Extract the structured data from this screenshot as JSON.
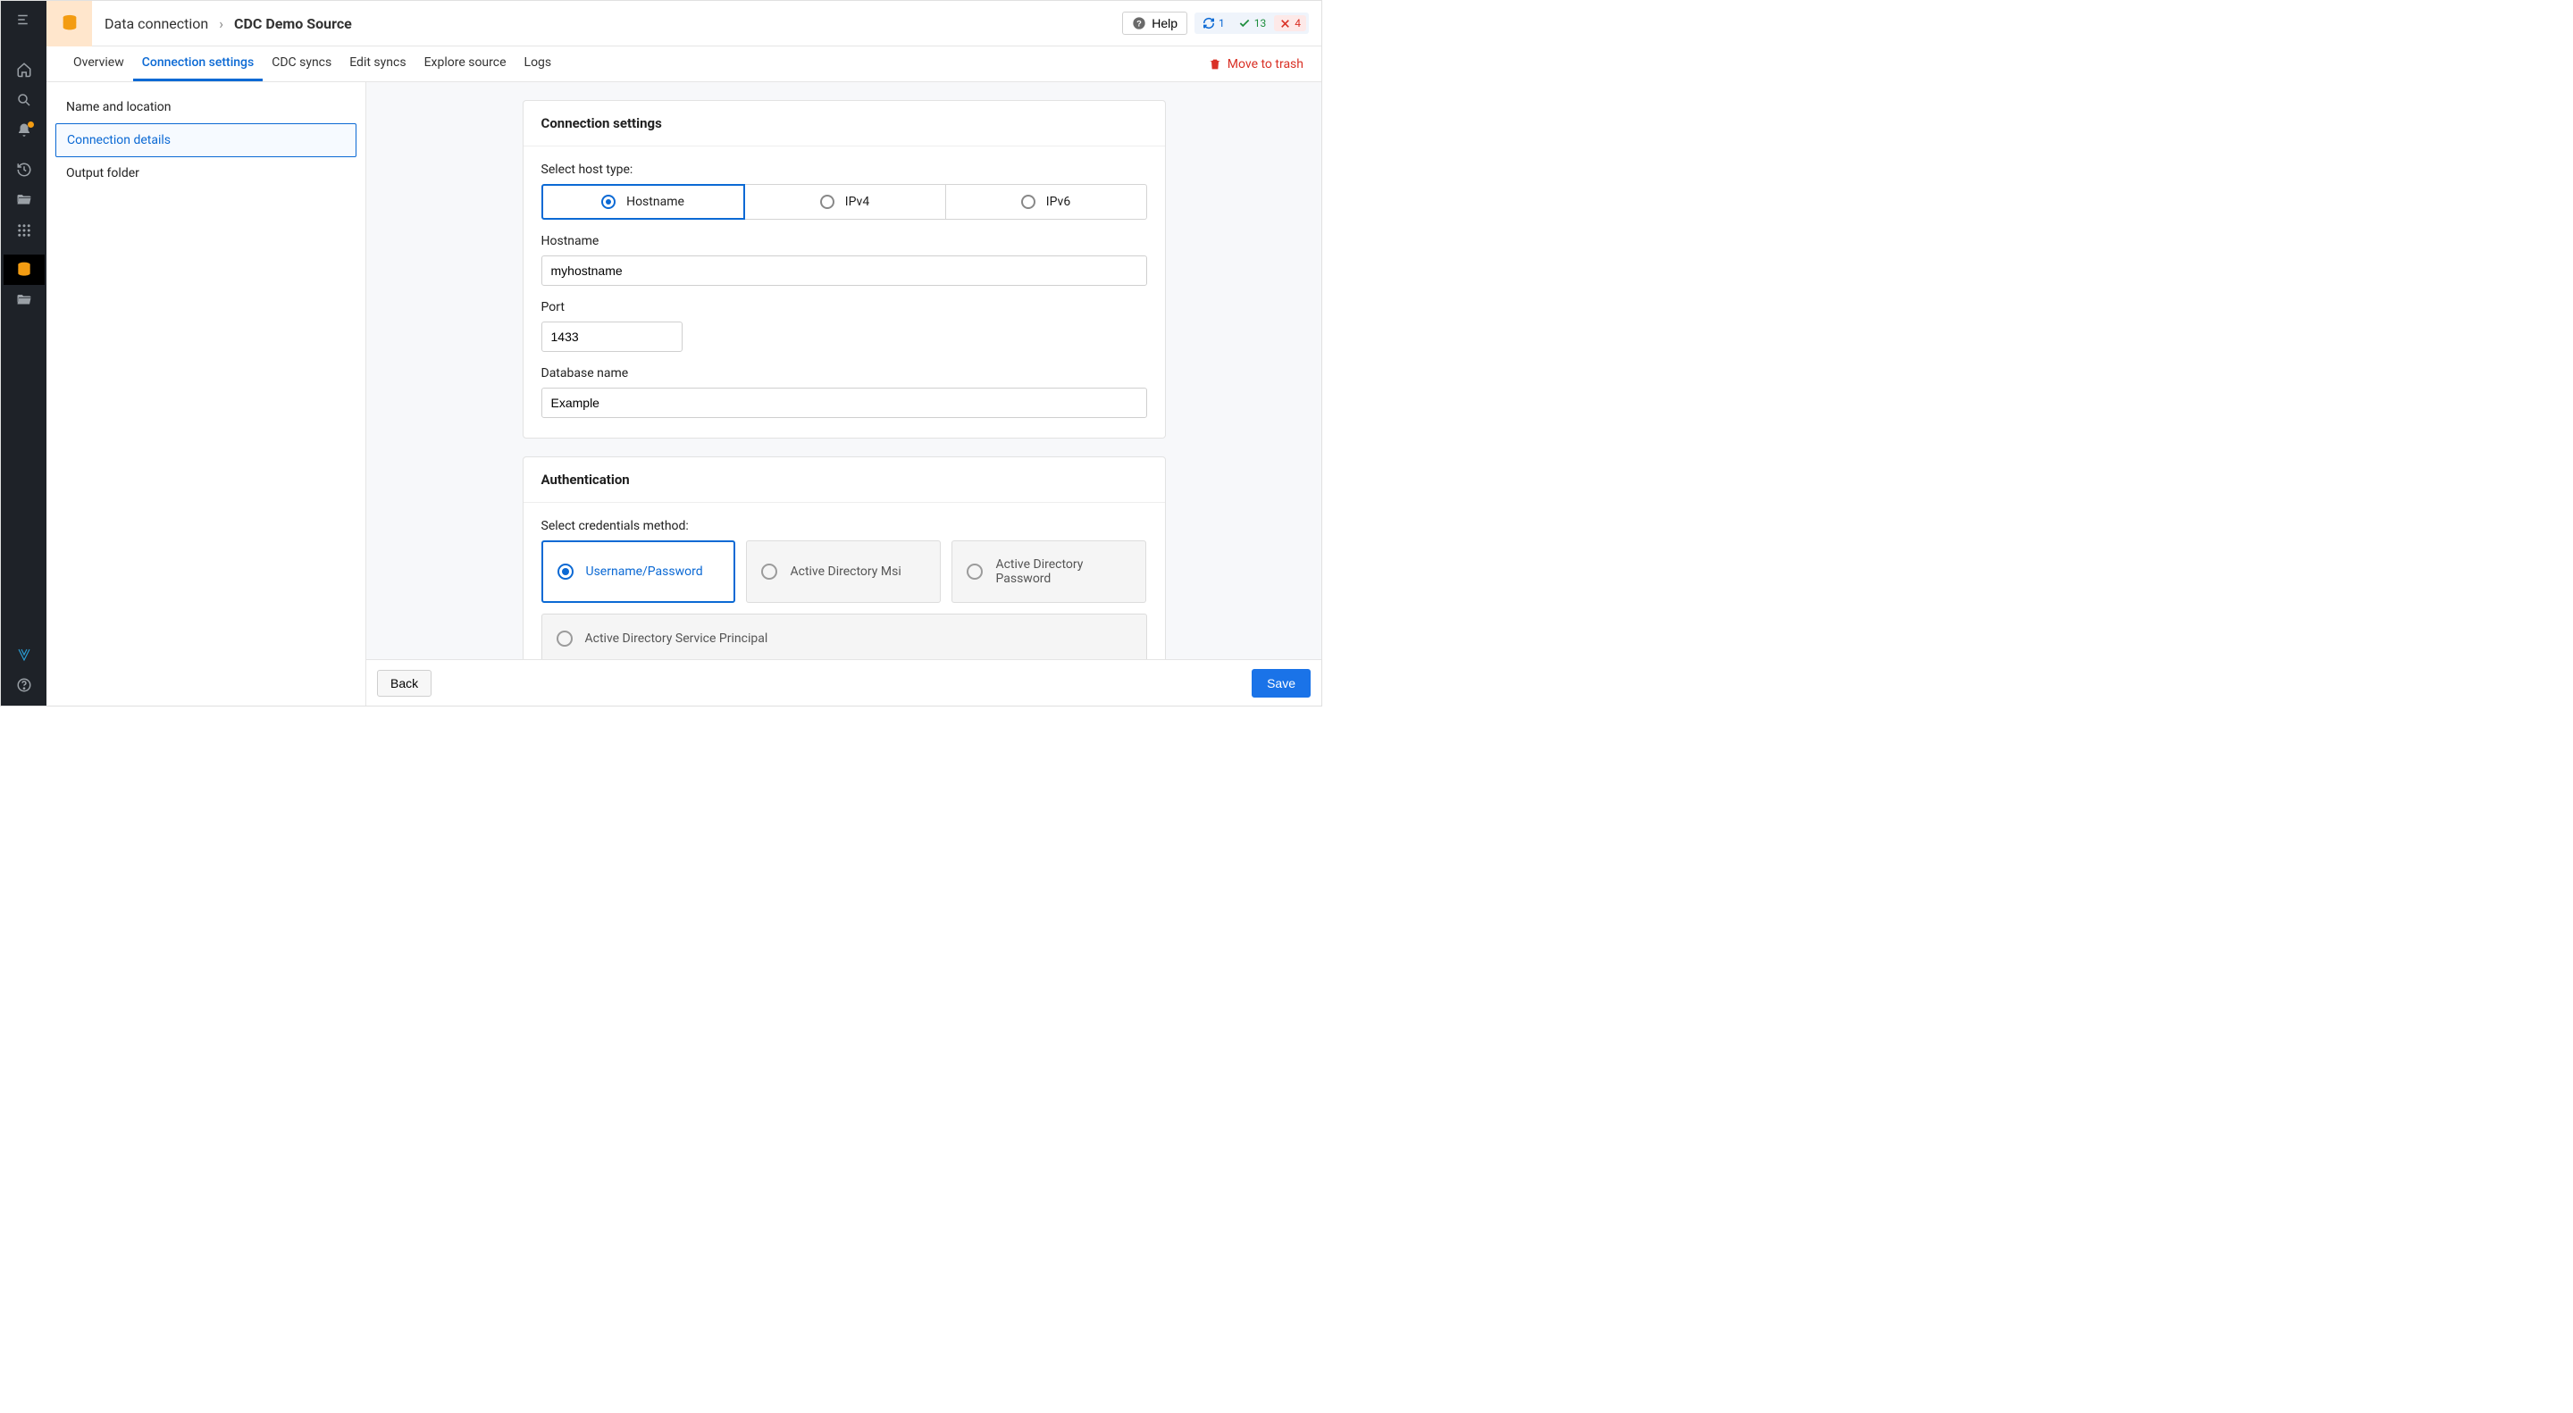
{
  "breadcrumb": {
    "root": "Data connection",
    "current": "CDC Demo Source"
  },
  "header": {
    "help": "Help",
    "counts": {
      "sync": "1",
      "ok": "13",
      "err": "4"
    }
  },
  "tabs": {
    "overview": "Overview",
    "conn": "Connection settings",
    "cdc": "CDC syncs",
    "edit": "Edit syncs",
    "explore": "Explore source",
    "logs": "Logs",
    "trash": "Move to trash"
  },
  "side": {
    "name_loc": "Name and location",
    "conn_details": "Connection details",
    "output": "Output folder"
  },
  "conn_panel": {
    "title": "Connection settings",
    "host_type_label": "Select host type:",
    "opts": {
      "hostname": "Hostname",
      "ipv4": "IPv4",
      "ipv6": "IPv6"
    },
    "hostname_label": "Hostname",
    "hostname_value": "myhostname",
    "port_label": "Port",
    "port_value": "1433",
    "db_label": "Database name",
    "db_value": "Example"
  },
  "auth_panel": {
    "title": "Authentication",
    "method_label": "Select credentials method:",
    "opts": {
      "userpass": "Username/Password",
      "msi": "Active Directory Msi",
      "adpass": "Active Directory Password",
      "svcprin": "Active Directory Service Principal"
    }
  },
  "footer": {
    "back": "Back",
    "save": "Save"
  }
}
